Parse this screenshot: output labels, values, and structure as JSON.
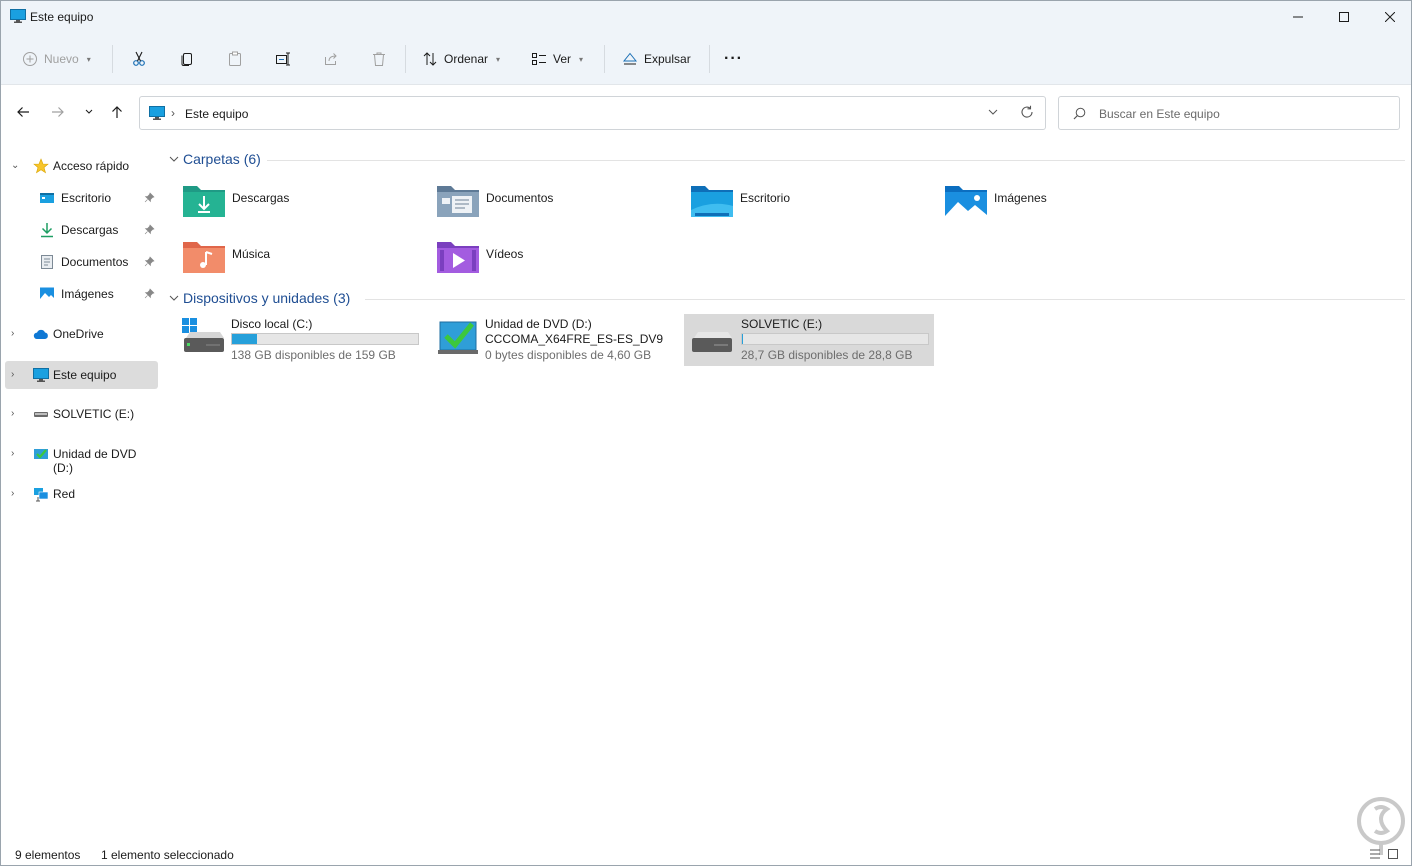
{
  "window": {
    "title": "Este equipo",
    "controls": {
      "minimize": "—",
      "maximize": "☐",
      "close": "✕"
    }
  },
  "toolbar": {
    "new_label": "Nuevo",
    "sort_label": "Ordenar",
    "view_label": "Ver",
    "eject_label": "Expulsar",
    "more_label": "···"
  },
  "address": {
    "crumb": "Este equipo",
    "search_placeholder": "Buscar en Este equipo"
  },
  "sidebar": {
    "quick_access": "Acceso rápido",
    "quick_items": [
      {
        "label": "Escritorio"
      },
      {
        "label": "Descargas"
      },
      {
        "label": "Documentos"
      },
      {
        "label": "Imágenes"
      }
    ],
    "items": [
      {
        "label": "OneDrive"
      },
      {
        "label": "Este equipo"
      },
      {
        "label": "SOLVETIC (E:)"
      },
      {
        "label": "Unidad de DVD (D:)"
      },
      {
        "label": "Red"
      }
    ]
  },
  "folders_group": {
    "title": "Carpetas (6)",
    "items": [
      {
        "label": "Descargas"
      },
      {
        "label": "Documentos"
      },
      {
        "label": "Escritorio"
      },
      {
        "label": "Imágenes"
      },
      {
        "label": "Música"
      },
      {
        "label": "Vídeos"
      }
    ]
  },
  "devices_group": {
    "title": "Dispositivos y unidades (3)",
    "drives": [
      {
        "name": "Disco local (C:)",
        "free": "138 GB disponibles de 159 GB",
        "used_fraction": 0.132
      },
      {
        "name": "Unidad de DVD (D:)",
        "volume": "CCCOMA_X64FRE_ES-ES_DV9",
        "free": "0 bytes disponibles de 4,60 GB"
      },
      {
        "name": "SOLVETIC (E:)",
        "free": "28,7 GB disponibles de 28,8 GB",
        "used_fraction": 0.003
      }
    ]
  },
  "status": {
    "count": "9 elementos",
    "selection": "1 elemento seleccionado"
  },
  "colors": {
    "accent": "#0067c0",
    "group_title": "#1f4e93",
    "drive_bar": "#26a0da"
  }
}
